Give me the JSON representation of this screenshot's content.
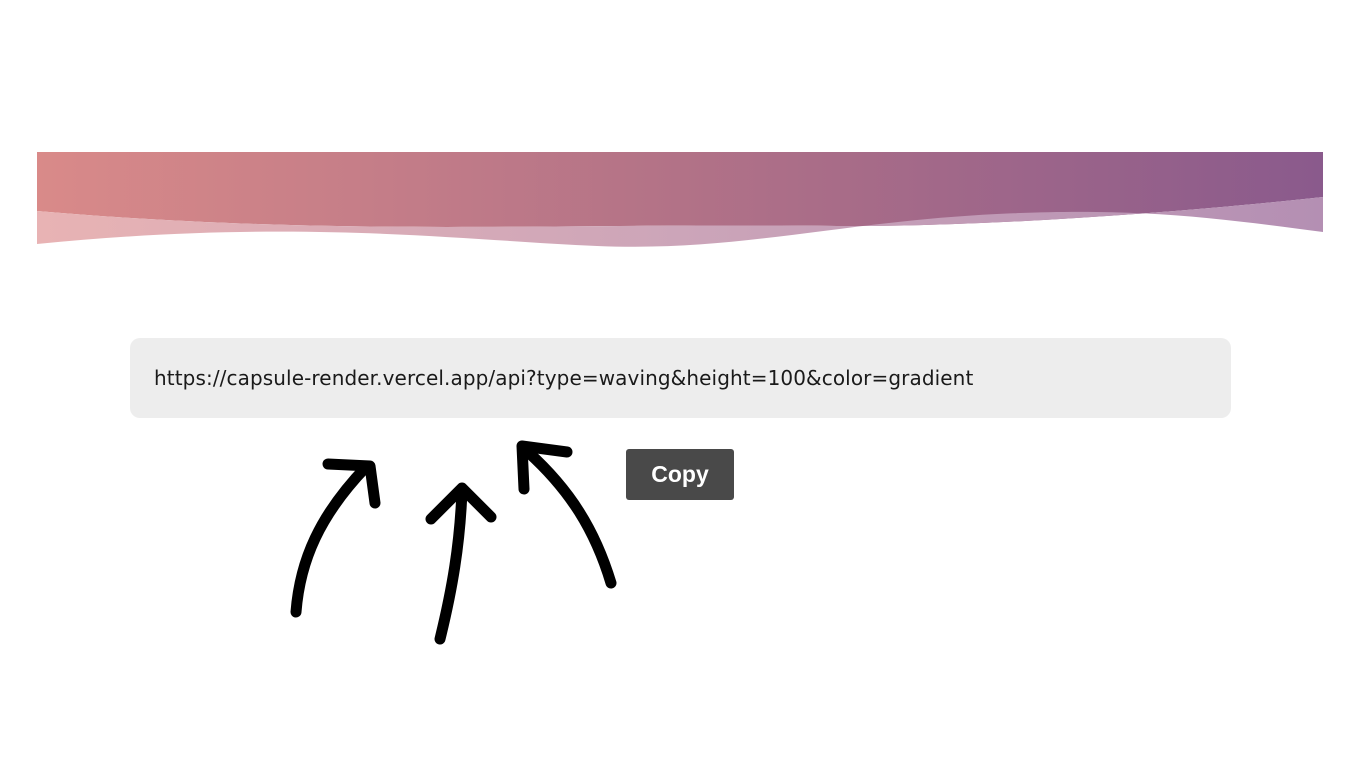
{
  "banner": {
    "type": "waving",
    "gradient_start": "#d98a89",
    "gradient_end": "#8a5a8c",
    "wave_light_start": "#e8b3b4",
    "wave_light_end": "#b48fb3"
  },
  "url_box": {
    "value": "https://capsule-render.vercel.app/api?type=waving&height=100&color=gradient",
    "background": "#ededed"
  },
  "copy_button": {
    "label": "Copy",
    "background": "#494949"
  },
  "annotations": {
    "arrow_color": "#000000",
    "icons": [
      "curved-arrow-icon",
      "straight-arrow-icon",
      "curved-arrow-icon"
    ]
  }
}
